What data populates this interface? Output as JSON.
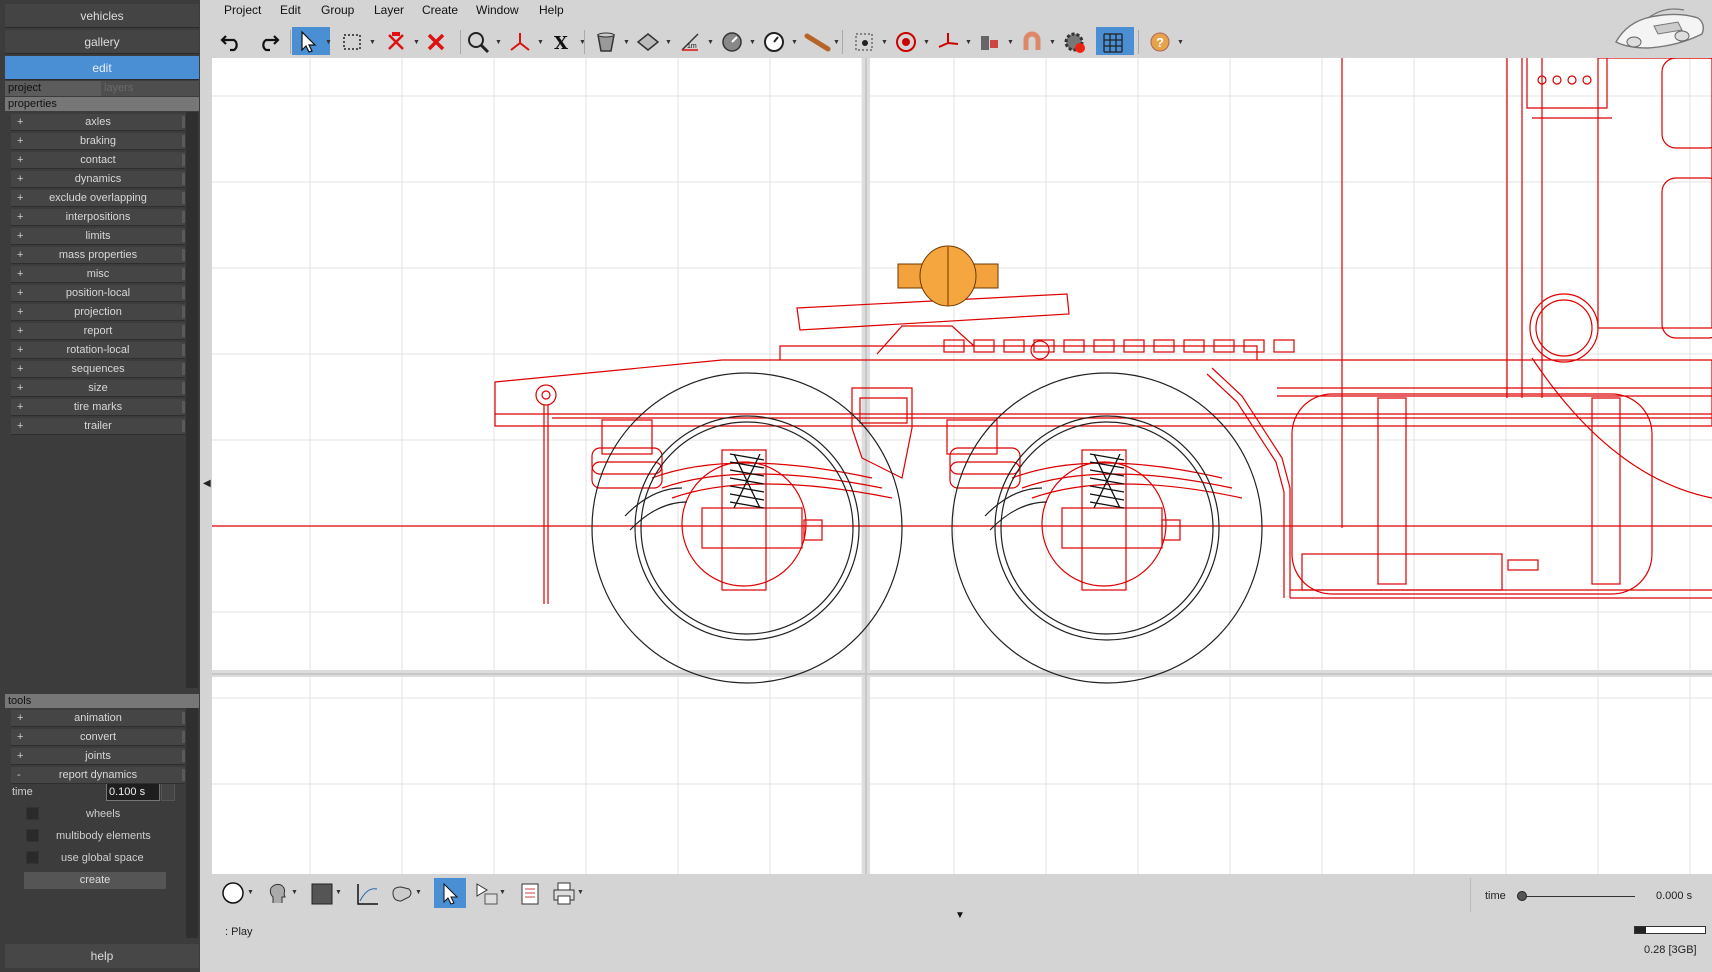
{
  "nav": {
    "vehicles": "vehicles",
    "gallery": "gallery",
    "edit": "edit"
  },
  "tabs": {
    "project": "project",
    "layers": "layers"
  },
  "properties": {
    "header": "properties",
    "items": [
      "axles",
      "braking",
      "contact",
      "dynamics",
      "exclude overlapping",
      "interpositions",
      "limits",
      "mass properties",
      "misc",
      "position-local",
      "projection",
      "report",
      "rotation-local",
      "sequences",
      "size",
      "tire marks",
      "trailer"
    ]
  },
  "tools": {
    "header": "tools",
    "items": [
      "animation",
      "convert",
      "joints"
    ],
    "expanded": "report dynamics",
    "time_label": "time",
    "time_value": "0.100 s",
    "checks": [
      "wheels",
      "multibody elements",
      "use global space"
    ],
    "create": "create"
  },
  "help": "help",
  "menu": [
    "Project",
    "Edit",
    "Group",
    "Layer",
    "Create",
    "Window",
    "Help"
  ],
  "toolbar_icons": [
    "undo-icon",
    "redo-icon",
    "select-arrow-icon",
    "rect-select-icon",
    "transform-icon",
    "delete-icon",
    "zoom-icon",
    "axes-icon",
    "x-axis-icon",
    "bucket-icon",
    "plane-icon",
    "measure-icon",
    "gauge-icon",
    "clock-icon",
    "rod-icon",
    "point-icon",
    "target-icon",
    "axis-tripod-icon",
    "joint-icon",
    "magnet-icon",
    "settings-gear-icon",
    "grid-icon",
    "help-icon"
  ],
  "bottom": {
    "status": ": Play",
    "time_label": "time",
    "time_value": "0.000 s",
    "memory": "0.28 [3GB]",
    "memory_fraction": 0.15
  }
}
